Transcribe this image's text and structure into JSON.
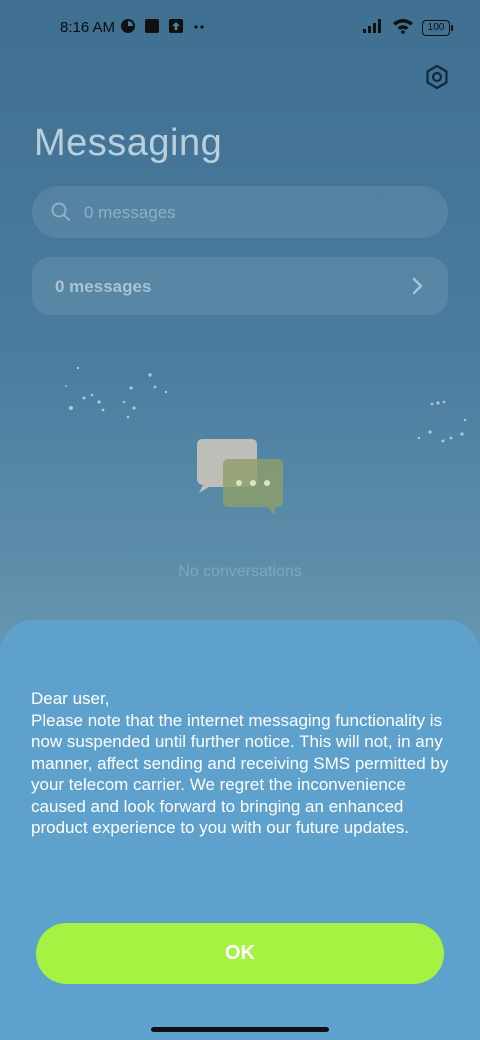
{
  "status_bar": {
    "time": "8:16 AM",
    "battery": "100",
    "icons_left": [
      "data-saver-icon",
      "notification-square-icon",
      "upload-arrow-icon",
      "more-dots-icon"
    ],
    "icons_right": [
      "cellular-signal-icon",
      "wifi-icon",
      "battery-icon"
    ]
  },
  "header": {
    "title": "Messaging",
    "settings_icon": "gear-icon"
  },
  "search": {
    "placeholder": "0 messages"
  },
  "messages_card": {
    "label": "0 messages"
  },
  "empty_state": {
    "text": "No conversations",
    "icon": "chat-bubbles-icon"
  },
  "dialog": {
    "message": "Dear user,\nPlease note that the internet messaging functionality is now suspended until further notice. This will not, in any manner, affect sending and receiving SMS permitted by your telecom carrier. We regret the inconvenience caused and look forward to bringing an enhanced product experience to you with our future updates.",
    "ok_label": "OK"
  },
  "colors": {
    "accent_button": "#a6f242",
    "dialog_background": "#5ea1cc"
  }
}
